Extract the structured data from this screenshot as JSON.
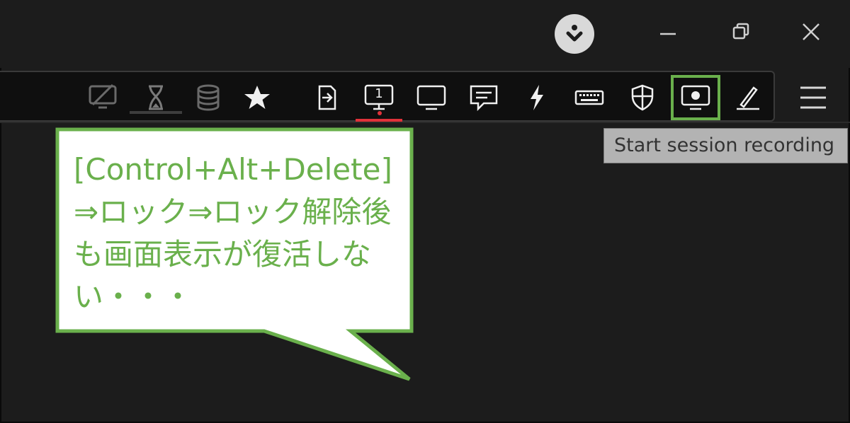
{
  "tooltip": {
    "text": "Start session recording"
  },
  "callout": {
    "text": "[Control+Alt+Delete]⇒ロック⇒ロック解除後も画面表示が復活しない・・・"
  },
  "toolbar": {
    "icons": [
      "screen-off-icon",
      "hourglass-icon",
      "database-icon",
      "star-icon",
      "send-file-icon",
      "monitor-1-icon",
      "monitor-icon",
      "chat-icon",
      "lightning-icon",
      "keyboard-icon",
      "shield-icon",
      "record-icon",
      "pen-icon"
    ],
    "monitor_number": "1"
  },
  "colors": {
    "accent_green": "#6ab04c",
    "active_red": "#e0323a",
    "background": "#1c1c1c"
  }
}
